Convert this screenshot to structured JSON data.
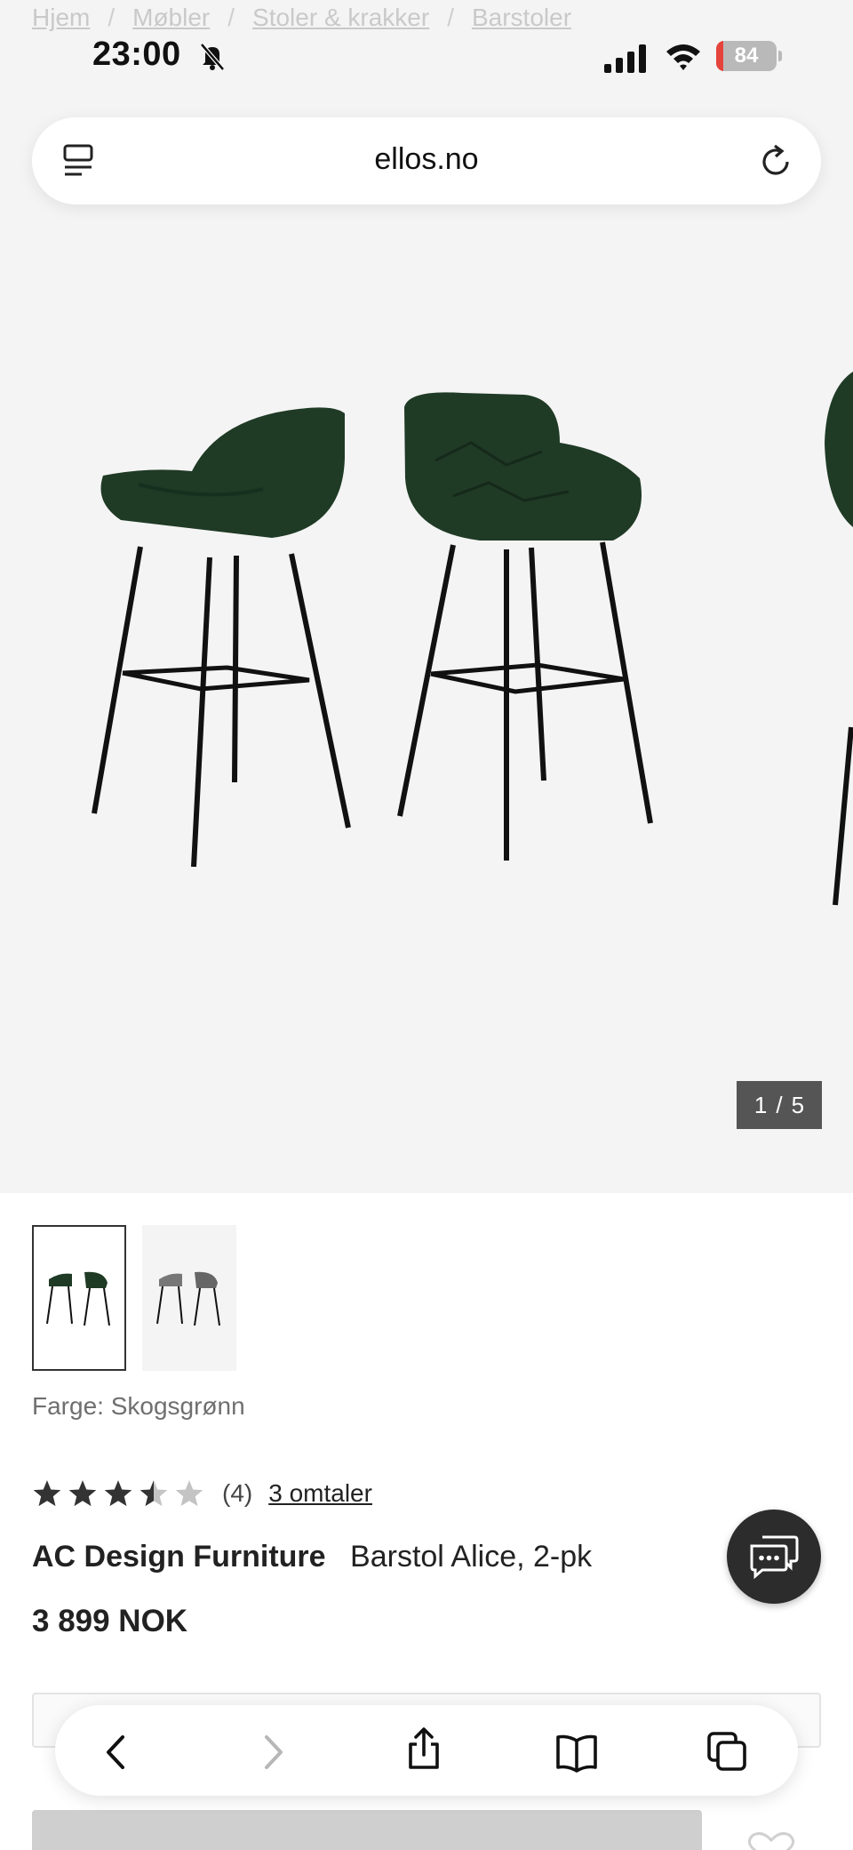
{
  "breadcrumb": {
    "items": [
      "Hjem",
      "Møbler",
      "Stoler & krakker",
      "Barstoler"
    ],
    "separator": "/"
  },
  "status_bar": {
    "time": "23:00",
    "battery": "84",
    "icons": [
      "bell-slash-icon",
      "signal-icon",
      "wifi-icon",
      "battery-icon"
    ]
  },
  "browser": {
    "url": "ellos.no",
    "toolbar_icons": [
      "back-icon",
      "forward-icon",
      "share-icon",
      "bookmarks-icon",
      "tabs-icon"
    ]
  },
  "gallery": {
    "counter_current": "1",
    "counter_separator": "/",
    "counter_total": "5"
  },
  "product": {
    "color_label": "Farge: Skogsgrønn",
    "rating_value": 3.5,
    "rating_max": 5,
    "rating_count": "(4)",
    "reviews_link": "3 omtaler",
    "brand": "AC Design Furniture",
    "name": "Barstol Alice, 2-pk",
    "price": "3 899 NOK"
  },
  "colors": {
    "chair_green": "#1f3a25",
    "legs": "#111111",
    "image_bg": "#f4f4f4",
    "chat_button": "#2c2c2c",
    "counter_bg": "#555555"
  }
}
